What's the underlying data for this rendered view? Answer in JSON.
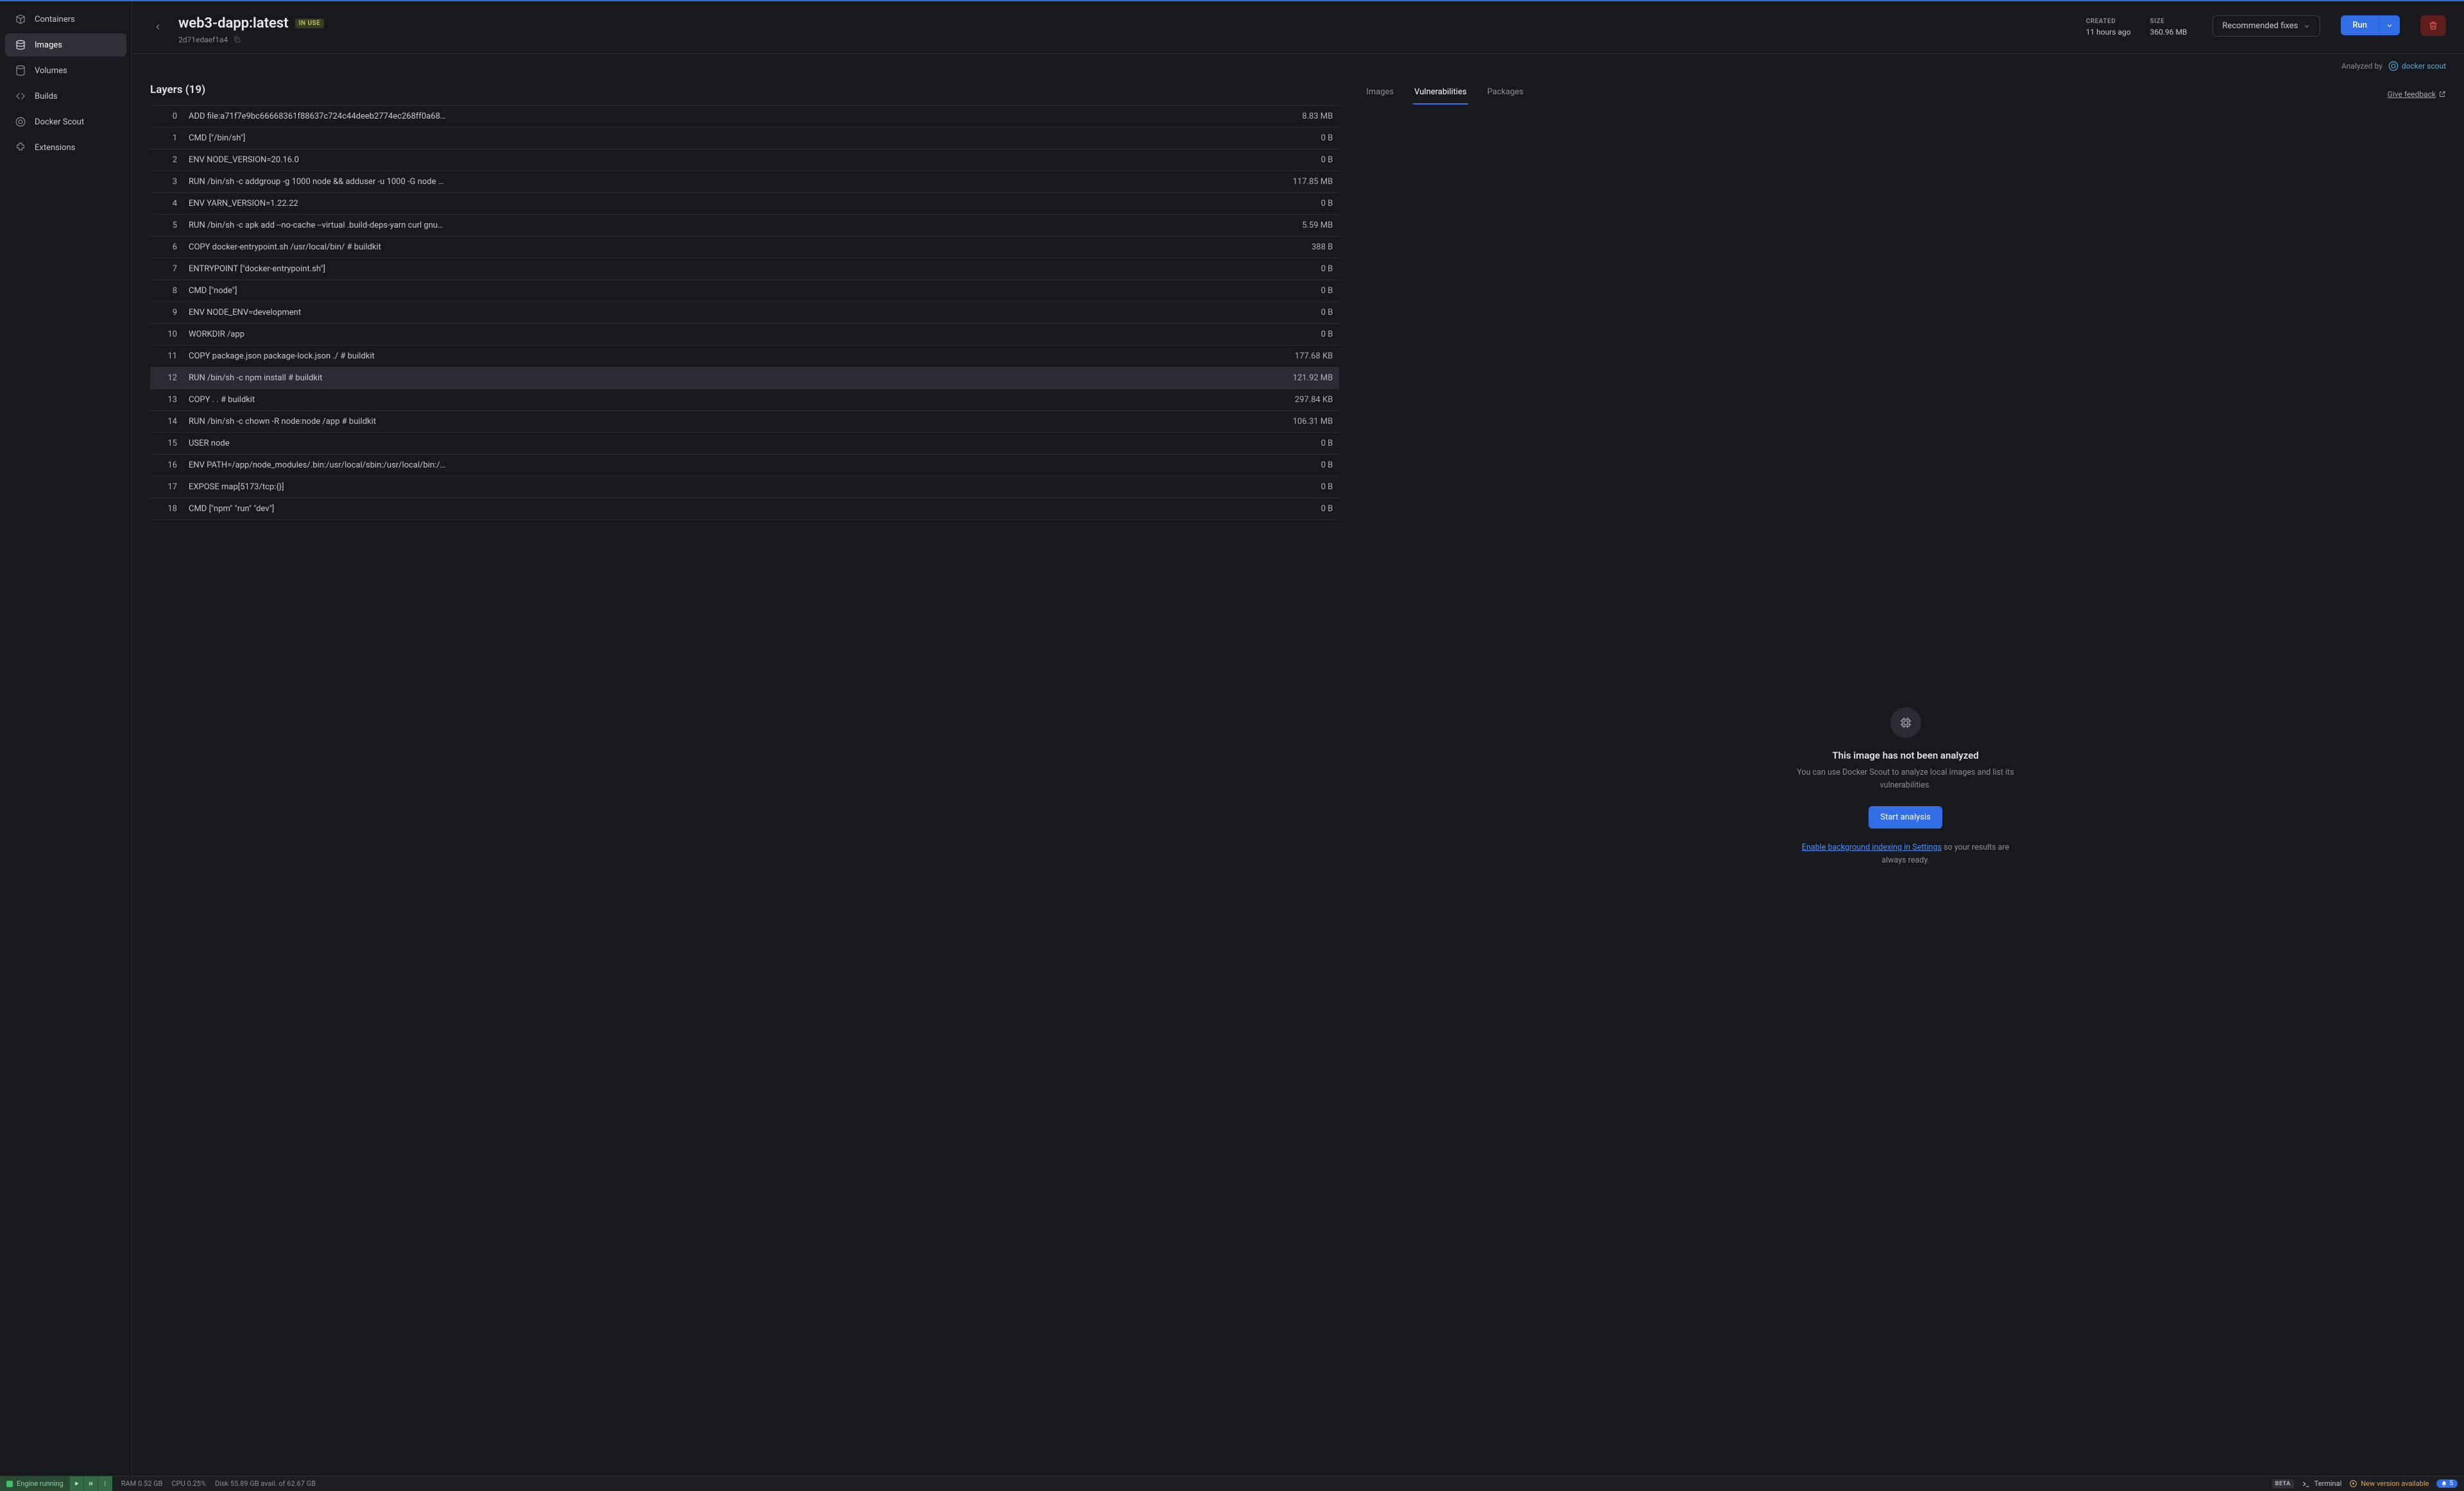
{
  "sidebar": {
    "items": [
      {
        "label": "Containers",
        "icon": "containers-icon"
      },
      {
        "label": "Images",
        "icon": "images-icon"
      },
      {
        "label": "Volumes",
        "icon": "volumes-icon"
      },
      {
        "label": "Builds",
        "icon": "builds-icon"
      },
      {
        "label": "Docker Scout",
        "icon": "scout-icon"
      },
      {
        "label": "Extensions",
        "icon": "extensions-icon"
      }
    ]
  },
  "header": {
    "title": "web3-dapp:latest",
    "in_use_badge": "IN USE",
    "image_id": "2d71edaef1a4",
    "created_label": "CREATED",
    "created_value": "11 hours ago",
    "size_label": "SIZE",
    "size_value": "360.96 MB",
    "rec_fixes": "Recommended fixes",
    "run_label": "Run"
  },
  "scout_row": {
    "analyzed_by": "Analyzed by",
    "brand": "docker scout"
  },
  "layers_panel": {
    "title": "Layers (19)",
    "rows": [
      {
        "idx": "0",
        "cmd": "ADD file:a71f7e9bc66668361f88637c724c44deeb2774ec268ff0a68…",
        "size": "8.83 MB"
      },
      {
        "idx": "1",
        "cmd": "CMD [\"/bin/sh\"]",
        "size": "0 B"
      },
      {
        "idx": "2",
        "cmd": "ENV NODE_VERSION=20.16.0",
        "size": "0 B"
      },
      {
        "idx": "3",
        "cmd": "RUN /bin/sh -c addgroup -g 1000 node && adduser -u 1000 -G node …",
        "size": "117.85 MB"
      },
      {
        "idx": "4",
        "cmd": "ENV YARN_VERSION=1.22.22",
        "size": "0 B"
      },
      {
        "idx": "5",
        "cmd": "RUN /bin/sh -c apk add --no-cache --virtual .build-deps-yarn curl gnu…",
        "size": "5.59 MB"
      },
      {
        "idx": "6",
        "cmd": "COPY docker-entrypoint.sh /usr/local/bin/ # buildkit",
        "size": "388 B"
      },
      {
        "idx": "7",
        "cmd": "ENTRYPOINT [\"docker-entrypoint.sh\"]",
        "size": "0 B"
      },
      {
        "idx": "8",
        "cmd": "CMD [\"node\"]",
        "size": "0 B"
      },
      {
        "idx": "9",
        "cmd": "ENV NODE_ENV=development",
        "size": "0 B"
      },
      {
        "idx": "10",
        "cmd": "WORKDIR /app",
        "size": "0 B"
      },
      {
        "idx": "11",
        "cmd": "COPY package.json package-lock.json ./ # buildkit",
        "size": "177.68 KB"
      },
      {
        "idx": "12",
        "cmd": "RUN /bin/sh -c npm install # buildkit",
        "size": "121.92 MB"
      },
      {
        "idx": "13",
        "cmd": "COPY . . # buildkit",
        "size": "297.84 KB"
      },
      {
        "idx": "14",
        "cmd": "RUN /bin/sh -c chown -R node:node /app # buildkit",
        "size": "106.31 MB"
      },
      {
        "idx": "15",
        "cmd": "USER node",
        "size": "0 B"
      },
      {
        "idx": "16",
        "cmd": "ENV PATH=/app/node_modules/.bin:/usr/local/sbin:/usr/local/bin:/…",
        "size": "0 B"
      },
      {
        "idx": "17",
        "cmd": "EXPOSE map[5173/tcp:{}]",
        "size": "0 B"
      },
      {
        "idx": "18",
        "cmd": "CMD [\"npm\" \"run\" \"dev\"]",
        "size": "0 B"
      }
    ]
  },
  "right_panel": {
    "tabs": [
      "Images",
      "Vulnerabilities",
      "Packages"
    ],
    "feedback": "Give feedback",
    "empty": {
      "title": "This image has not been analyzed",
      "text": "You can use Docker Scout to analyze local images and list its vulnerabilities.",
      "button": "Start analysis",
      "link": "Enable background indexing in Settings",
      "after_link": " so your results are always ready."
    }
  },
  "statusbar": {
    "engine": "Engine running",
    "ram": "RAM 0.52 GB",
    "cpu": "CPU 0.25%",
    "disk": "Disk 55.89 GB avail. of 62.67 GB",
    "beta": "BETA",
    "terminal": "Terminal",
    "update": "New version available",
    "notif_count": "5"
  }
}
